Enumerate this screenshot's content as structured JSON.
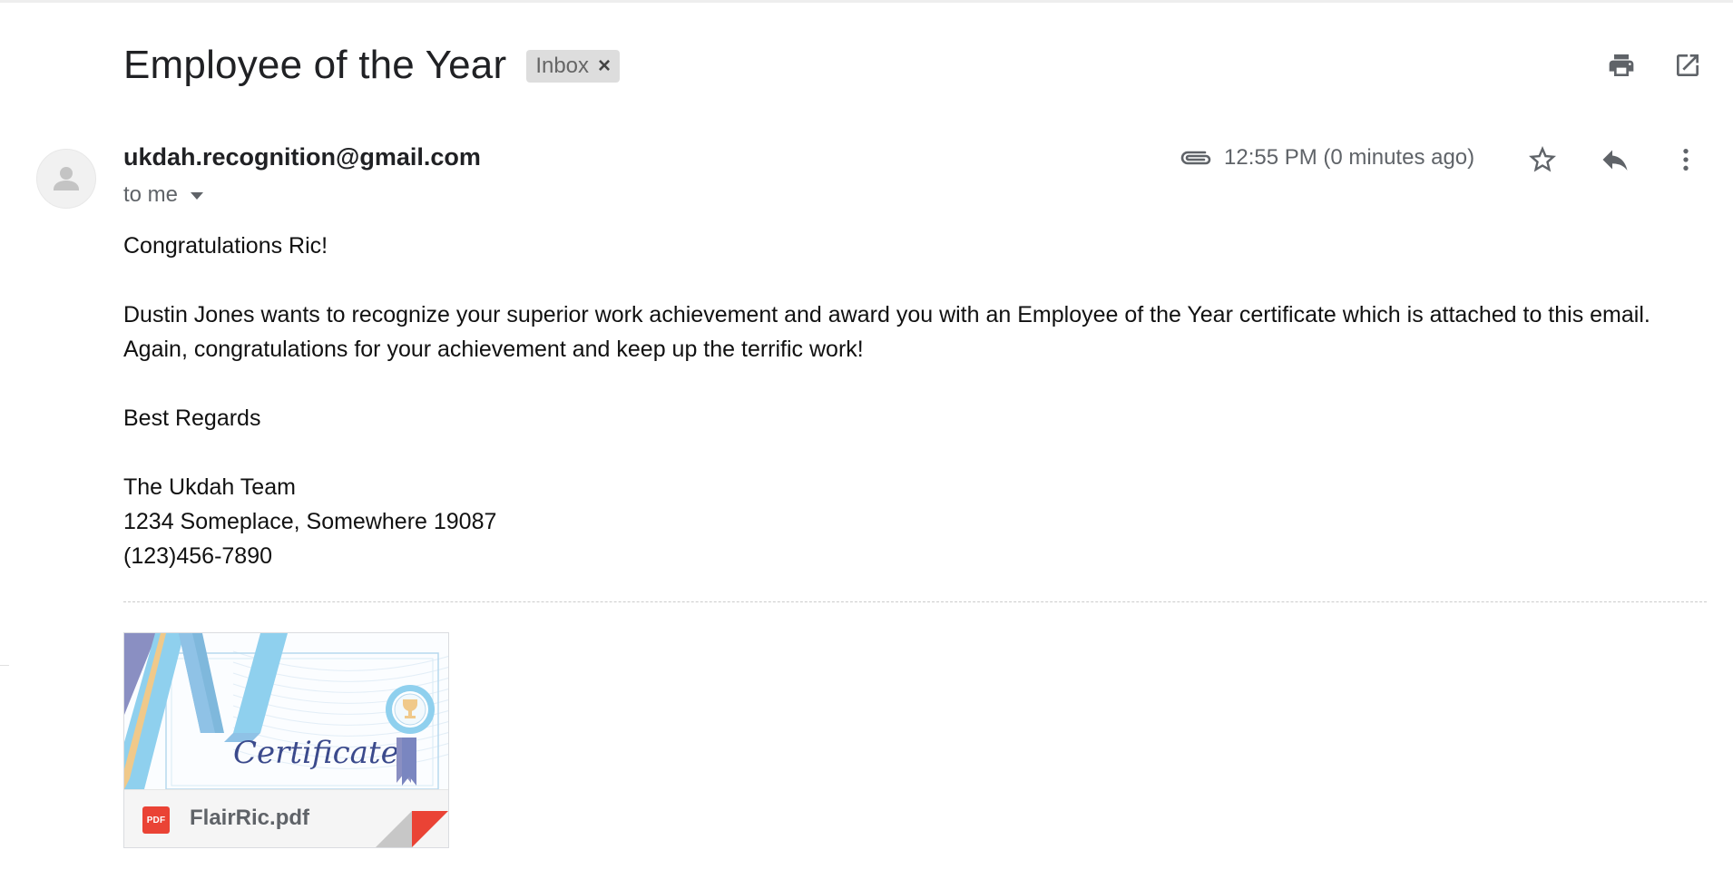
{
  "subject": {
    "title": "Employee of the Year",
    "label_chip": "Inbox",
    "chip_close_glyph": "×"
  },
  "toolbar": {
    "print_icon": "print-icon",
    "popout_icon": "open-in-new-window-icon"
  },
  "message": {
    "sender": "ukdah.recognition@gmail.com",
    "recipient": "to me",
    "timestamp": "12:55 PM (0 minutes ago)",
    "icons": [
      "paperclip-icon",
      "star-icon",
      "reply-icon",
      "more-vert-icon",
      "avatar-person-icon"
    ]
  },
  "body": {
    "greeting": "Congratulations Ric!",
    "paragraph": "Dustin Jones wants to recognize your superior work achievement and award you with an Employee of the Year certificate which is attached to this email. Again, congratulations for your achievement and keep up the terrific work!",
    "closing": "Best Regards",
    "signature_team": "The Ukdah Team",
    "signature_address": "1234 Someplace, Somewhere 19087",
    "signature_phone": "(123)456-7890"
  },
  "attachment": {
    "preview_text": "Certificate",
    "type_badge": "PDF",
    "file_name": "FlairRic.pdf"
  },
  "colors": {
    "accent_pdf": "#ea4335",
    "chip_bg": "#dddddd",
    "muted_text": "#5f6368"
  }
}
